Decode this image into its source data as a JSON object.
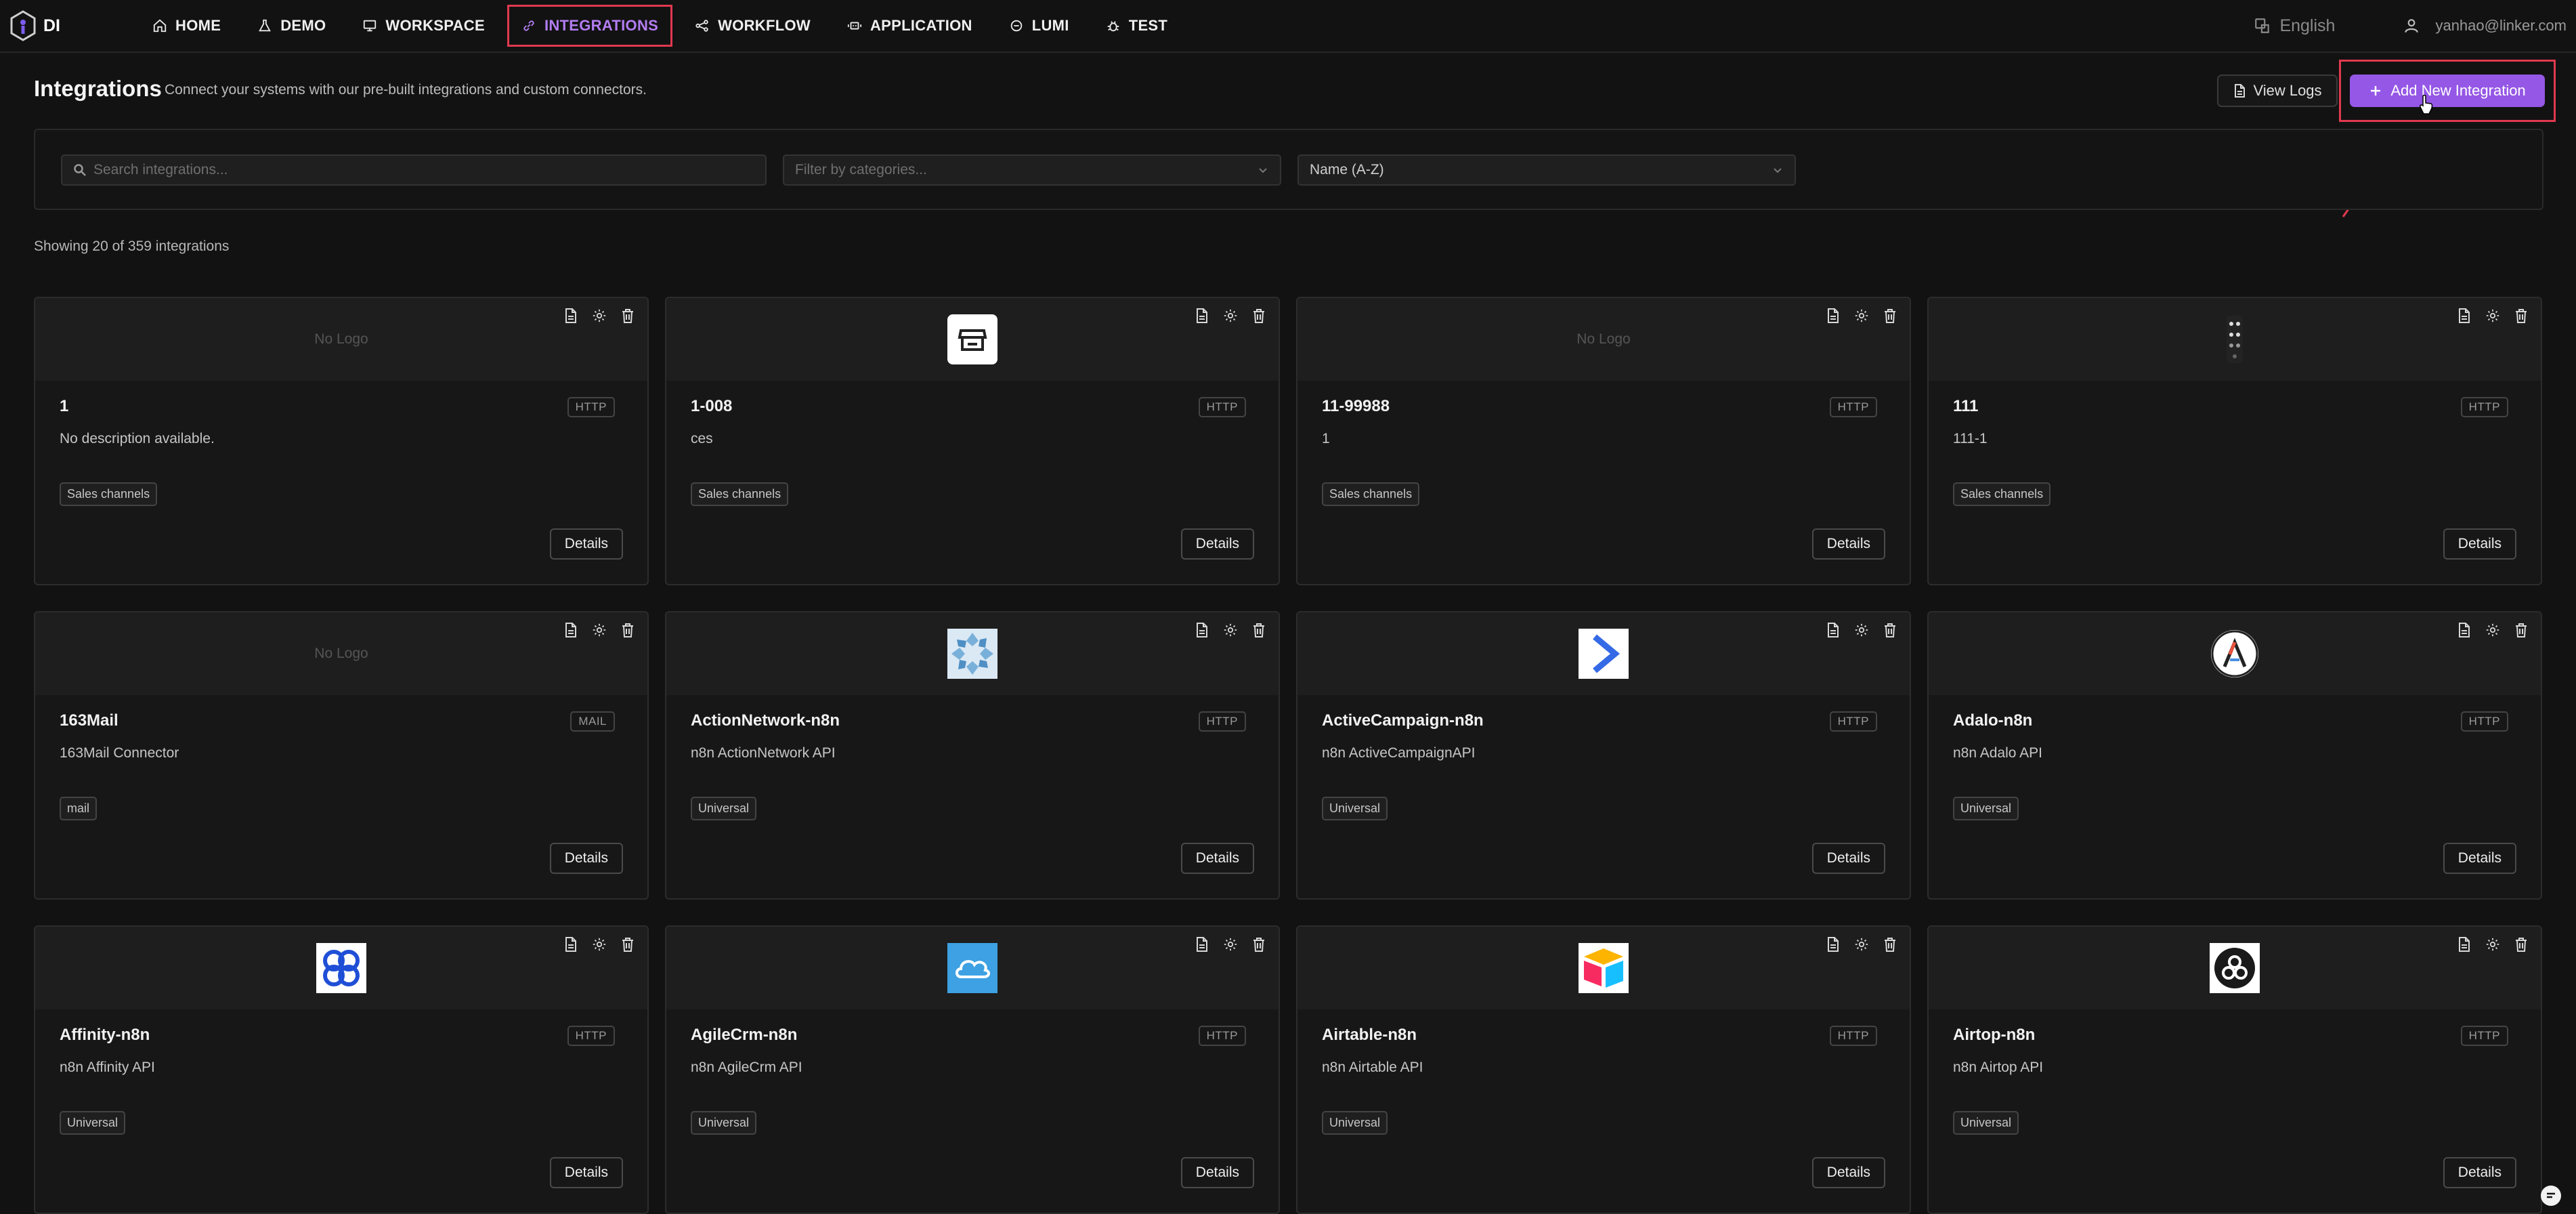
{
  "brand": {
    "name": "DI"
  },
  "nav": [
    {
      "label": "HOME",
      "icon": "home-icon"
    },
    {
      "label": "DEMO",
      "icon": "flask-icon"
    },
    {
      "label": "WORKSPACE",
      "icon": "monitor-icon"
    },
    {
      "label": "INTEGRATIONS",
      "icon": "link-icon",
      "active": true
    },
    {
      "label": "WORKFLOW",
      "icon": "workflow-icon"
    },
    {
      "label": "APPLICATION",
      "icon": "app-icon"
    },
    {
      "label": "LUMI",
      "icon": "chat-icon"
    },
    {
      "label": "TEST",
      "icon": "bug-icon"
    }
  ],
  "header_right": {
    "language": "English",
    "user": "yanhao@linker.com"
  },
  "page": {
    "title": "Integrations",
    "subtitle": "Connect your systems with our pre-built integrations and custom connectors.",
    "view_logs_label": "View Logs",
    "add_label": "Add New Integration"
  },
  "filters": {
    "search_placeholder": "Search integrations...",
    "category_placeholder": "Filter by categories...",
    "sort_value": "Name (A-Z)"
  },
  "showing_text": "Showing 20 of 359 integrations",
  "cards": [
    {
      "title": "1",
      "badge": "HTTP",
      "desc": "No description available.",
      "tag": "Sales channels",
      "logo": "none",
      "details": "Details"
    },
    {
      "title": "1-008",
      "badge": "HTTP",
      "desc": "ces",
      "tag": "Sales channels",
      "logo": "store-icon",
      "details": "Details"
    },
    {
      "title": "11-99988",
      "badge": "HTTP",
      "desc": "1",
      "tag": "Sales channels",
      "logo": "none",
      "details": "Details"
    },
    {
      "title": "111",
      "badge": "HTTP",
      "desc": "111-1",
      "tag": "Sales channels",
      "logo": "dots-icon",
      "details": "Details"
    },
    {
      "title": "163Mail",
      "badge": "MAIL",
      "desc": "163Mail Connector",
      "tag": "mail",
      "logo": "none",
      "details": "Details"
    },
    {
      "title": "ActionNetwork-n8n",
      "badge": "HTTP",
      "desc": "n8n ActionNetwork API",
      "tag": "Universal",
      "logo": "actionnetwork-icon",
      "details": "Details"
    },
    {
      "title": "ActiveCampaign-n8n",
      "badge": "HTTP",
      "desc": "n8n ActiveCampaignAPI",
      "tag": "Universal",
      "logo": "activecampaign-icon",
      "details": "Details"
    },
    {
      "title": "Adalo-n8n",
      "badge": "HTTP",
      "desc": "n8n Adalo API",
      "tag": "Universal",
      "logo": "adalo-icon",
      "details": "Details"
    },
    {
      "title": "Affinity-n8n",
      "badge": "HTTP",
      "desc": "n8n Affinity API",
      "tag": "Universal",
      "logo": "affinity-icon",
      "details": "Details"
    },
    {
      "title": "AgileCrm-n8n",
      "badge": "HTTP",
      "desc": "n8n AgileCrm API",
      "tag": "Universal",
      "logo": "agilecrm-icon",
      "details": "Details"
    },
    {
      "title": "Airtable-n8n",
      "badge": "HTTP",
      "desc": "n8n Airtable API",
      "tag": "Universal",
      "logo": "airtable-icon",
      "details": "Details"
    },
    {
      "title": "Airtop-n8n",
      "badge": "HTTP",
      "desc": "n8n Airtop API",
      "tag": "Universal",
      "logo": "airtop-icon",
      "details": "Details"
    }
  ],
  "no_logo_text": "No Logo",
  "colors": {
    "accent": "#9557e6",
    "active_nav": "#b37ef2",
    "highlight": "#e0394f"
  }
}
